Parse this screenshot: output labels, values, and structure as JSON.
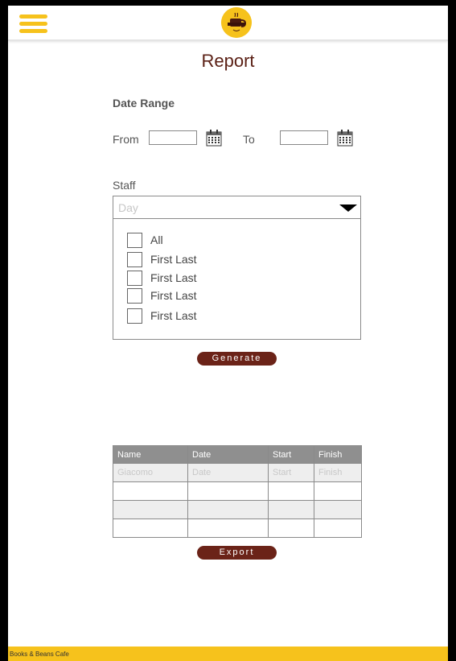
{
  "header": {
    "menu_icon": "hamburger-icon",
    "logo_icon": "cafe-logo-icon"
  },
  "page": {
    "title": "Report"
  },
  "date_range": {
    "heading": "Date Range",
    "from_label": "From",
    "from_value": "",
    "to_label": "To",
    "to_value": "",
    "calendar_icon": "calendar-icon"
  },
  "staff": {
    "label": "Staff",
    "select_value": "Day",
    "options": [
      {
        "label": "All",
        "checked": false
      },
      {
        "label": "First Last",
        "checked": false
      },
      {
        "label": "First Last",
        "checked": false
      },
      {
        "label": "First Last",
        "checked": false
      },
      {
        "label": "First Last",
        "checked": false
      }
    ]
  },
  "generate_button": "Generate",
  "table": {
    "headers": [
      "Name",
      "Date",
      "Start",
      "Finish"
    ],
    "rows": [
      [
        "Giacomo",
        "Date",
        "Start",
        "Finish"
      ],
      [
        "",
        "",
        "",
        ""
      ],
      [
        "",
        "",
        "",
        ""
      ],
      [
        "",
        "",
        "",
        ""
      ]
    ]
  },
  "export_button": "Export",
  "footer": {
    "text": "Books & Beans Cafe"
  },
  "colors": {
    "accent_yellow": "#f6c21c",
    "brand_brown": "#6b2318",
    "title_brown": "#5a1f14",
    "table_header": "#8f8f8f"
  }
}
